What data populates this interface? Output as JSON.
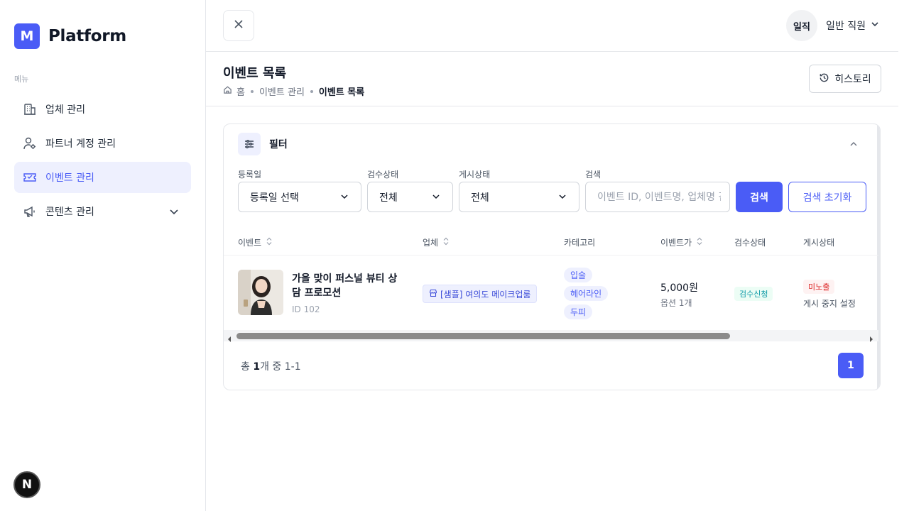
{
  "sidebar": {
    "logo_letter": "M",
    "logo_text": "Platform",
    "menu_caption": "메뉴",
    "items": [
      {
        "label": "업체 관리",
        "icon": "building-icon"
      },
      {
        "label": "파트너 계정 관리",
        "icon": "user-gear-icon"
      },
      {
        "label": "이벤트 관리",
        "icon": "ticket-icon",
        "active": true
      },
      {
        "label": "콘텐츠 관리",
        "icon": "megaphone-icon"
      }
    ],
    "badge": "N"
  },
  "topbar": {
    "avatar_text": "일직",
    "role_label": "일반 직원"
  },
  "header": {
    "title": "이벤트 목록",
    "breadcrumb": [
      "홈",
      "이벤트 관리",
      "이벤트 목록"
    ],
    "history_label": "히스토리"
  },
  "filter": {
    "title": "필터",
    "labels": {
      "date": "등록일",
      "review": "검수상태",
      "post": "게시상태",
      "search": "검색"
    },
    "date_value": "등록일 선택",
    "review_value": "전체",
    "post_value": "전체",
    "search_placeholder": "이벤트 ID, 이벤트명, 업체명 검색",
    "search_button": "검색",
    "reset_button": "검색 초기화"
  },
  "table": {
    "headers": [
      "이벤트",
      "업체",
      "카테고리",
      "이벤트가",
      "검수상태",
      "게시상태"
    ],
    "rows": [
      {
        "name": "가을 맞이 퍼스널 뷰티 상담 프로모션",
        "id": "ID 102",
        "vendor": "[샘플] 여의도 메이크업룸",
        "categories": [
          "입술",
          "헤어라인",
          "두피"
        ],
        "price": "5,000원",
        "option": "옵션 1개",
        "review": "검수신청",
        "post": "미노출",
        "post_sub": "게시 중지 설정"
      }
    ]
  },
  "pagination": {
    "total_prefix": "총 ",
    "total_count": "1",
    "total_suffix": "개 중 1-1",
    "current_page": "1"
  },
  "colors": {
    "accent": "#4a5cf6",
    "danger": "#dc2626",
    "teal": "#0e9aa7"
  }
}
